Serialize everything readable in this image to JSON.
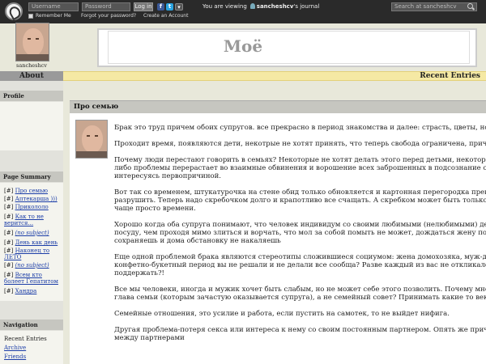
{
  "topbar": {
    "username_placeholder": "Username",
    "password_placeholder": "Password",
    "login_label": "Log in",
    "facebook_glyph": "f",
    "twitter_glyph": "t",
    "more_glyph": "▾",
    "remember_label": "Remember Me",
    "forgot_label": "Forgot your password?",
    "create_label": "Create an Account",
    "viewing_prefix": "You are viewing",
    "viewing_user": "sancheshcv",
    "viewing_suffix": "'s journal",
    "search_placeholder": "Search at sancheshcv"
  },
  "header": {
    "title": "Моё"
  },
  "sidebar": {
    "about": "About",
    "profile_title": "Profile",
    "profile_name": "sancheshcv",
    "summary_title": "Page Summary",
    "summary": [
      {
        "label": "Про семью",
        "italic": false
      },
      {
        "label": "Аптекарша )))",
        "italic": false
      },
      {
        "label": "Прикололо",
        "italic": false
      },
      {
        "label": "Как то не верится...",
        "italic": false
      },
      {
        "label": "(no subject)",
        "italic": true
      },
      {
        "label": "День как день",
        "italic": false
      },
      {
        "label": "Наконец то ЛЕТО",
        "italic": false
      },
      {
        "label": "(no subject)",
        "italic": true
      },
      {
        "label": "Всем кто болеет Гепатитом",
        "italic": false
      },
      {
        "label": "Хандра",
        "italic": false
      }
    ],
    "summary_marker": "[#]",
    "nav_title": "Navigation",
    "nav": {
      "recent": "Recent Entries",
      "archive": "Archive",
      "friends": "Friends"
    }
  },
  "main": {
    "recent_title": "Recent Entries",
    "entry_title": "Про семью",
    "paragraphs": [
      [
        "Брак это труд причем обоих супругов. все прекрасно в период знакомства и далее: страсть, цветы, ночи"
      ],
      [
        "Проходит время, появляются дети, некотрые не хотят принять, что теперь свобода ограничена, причем"
      ],
      [
        "Почему люди перестают говорить в семьях? Некоторые не хотят делать этого перед детьми, некоторые",
        "либо проблемы перерастает во взаимные обвинения и ворошение всех заброшенных в подсознание об",
        "интересуясь первопричиной."
      ],
      [
        "Вот так со временем, штукатурочка на стене обид только обновляется и картонная перегородка превра",
        "разрушить. Теперь надо скребочком долго и крапотливо все счащать. А скребком может быть только сп",
        "чаще просто времени."
      ],
      [
        "Хорошо когда оба супруга понимают, что человек индивидум со своими любимыми (нелюбимыми) дел",
        "посуду, чем проходя мимо злиться и ворчать, что мол за собой помыть не может, дождаться жену после",
        "сохраняешь и дома обстановку не накаляешь"
      ],
      [
        "Еще одной проблемой брака являются стереотипы сложившиеся социумом: жена домохозяка, муж-добы",
        "конфетно-букетный период вы не решали и не делали все сообща? Разве каждый из вас не откликался",
        "поддержать?!"
      ],
      [
        "Все мы человеки, иногда и мужик хочет быть слабым, но не может себе этого позволить. Почему многи",
        "глава семьи (которым зачастую оказывается супруга), а не семейный совет? Принимать какие то вектор"
      ],
      [
        "Семейные отношения, это усилие и работа, если пустить на самотек, то не выйдет нифига."
      ],
      [
        "Другая проблема-потеря секса или интереса к нему со своим постоянным партнером. Опять же причин",
        "между партнерами"
      ]
    ]
  },
  "colors": {
    "topbar": "#2a2a2a",
    "recent_bar": "#f5e9a4",
    "link": "#1c3ea8",
    "sidebar_head": "#c6c6c0"
  }
}
